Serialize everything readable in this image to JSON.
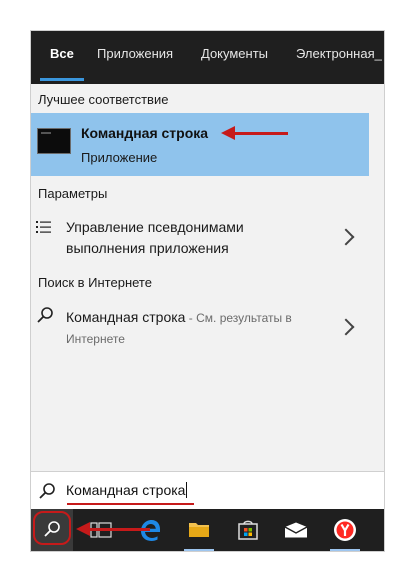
{
  "tabs": [
    {
      "label": "Все",
      "active": true
    },
    {
      "label": "Приложения"
    },
    {
      "label": "Документы"
    },
    {
      "label": "Электронная_"
    }
  ],
  "sections": {
    "best_match": "Лучшее соответствие",
    "settings": "Параметры",
    "web": "Поиск в Интернете"
  },
  "best_match": {
    "title": "Командная строка",
    "subtitle": "Приложение",
    "icon": "command-prompt-icon"
  },
  "settings_item": {
    "line1": "Управление псевдонимами",
    "line2": "выполнения приложения",
    "icon": "list-settings-icon"
  },
  "web_item": {
    "title": "Командная строка",
    "suffix": " - См. результаты в",
    "line2": "Интернете",
    "icon": "search-icon"
  },
  "search": {
    "value": "Командная строка",
    "icon": "search-icon"
  },
  "taskbar": {
    "items": [
      "search-button",
      "task-view-icon",
      "edge-icon",
      "file-explorer-icon",
      "store-icon",
      "mail-icon",
      "yandex-browser-icon"
    ]
  },
  "colors": {
    "accent": "#3a96dd",
    "highlight": "#8fc3ec",
    "annotation": "#c61a1a",
    "dark": "#1f1f1f"
  }
}
